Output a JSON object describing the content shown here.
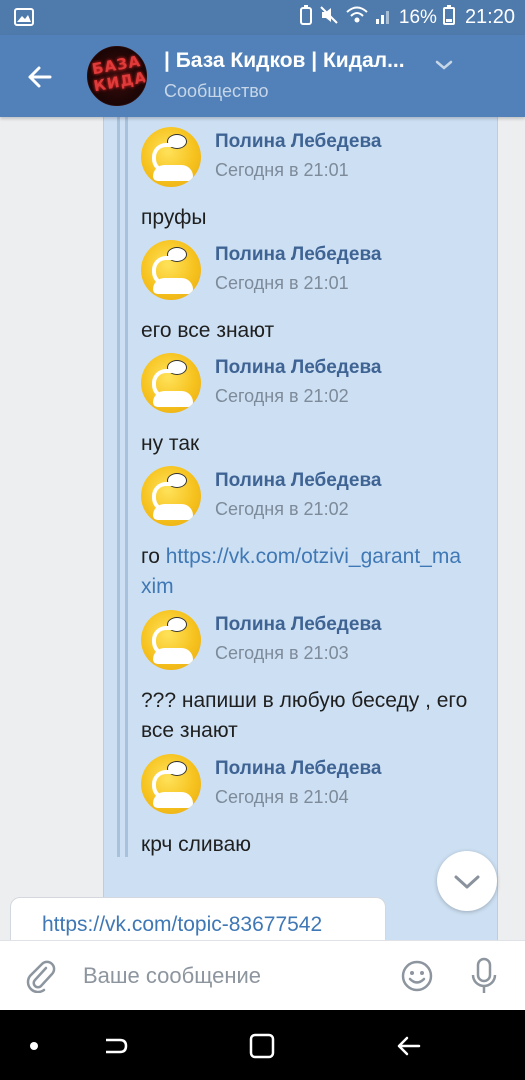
{
  "status_bar": {
    "battery": "16%",
    "time": "21:20"
  },
  "header": {
    "title": "| База Кидков | Кидал...",
    "subtitle": "Сообщество",
    "avatar_text": "БАЗА КИДАЛ"
  },
  "forwarded_messages": [
    {
      "author": "Полина Лебедева",
      "time": "Сегодня в 21:01",
      "text": "пруфы"
    },
    {
      "author": "Полина Лебедева",
      "time": "Сегодня в 21:01",
      "text": "его все знают"
    },
    {
      "author": "Полина Лебедева",
      "time": "Сегодня в 21:02",
      "text": "ну так"
    },
    {
      "author": "Полина Лебедева",
      "time": "Сегодня в 21:02",
      "text_prefix": "го ",
      "link": "https://vk.com/otzivi_garant_maxim"
    },
    {
      "author": "Полина Лебедева",
      "time": "Сегодня в 21:03",
      "text": "??? напиши в любую беседу , его все знают"
    },
    {
      "author": "Полина Лебедева",
      "time": "Сегодня в 21:04",
      "text": "крч сливаю"
    }
  ],
  "outgoing_message": {
    "link": "https://vk.com/topic-83677542"
  },
  "composer": {
    "placeholder": "Ваше сообщение"
  },
  "colors": {
    "header": "#5181b8",
    "status_bar": "#4f7aac",
    "bubble": "#cde0f3",
    "link": "#3f78b5",
    "author": "#3f6494"
  }
}
